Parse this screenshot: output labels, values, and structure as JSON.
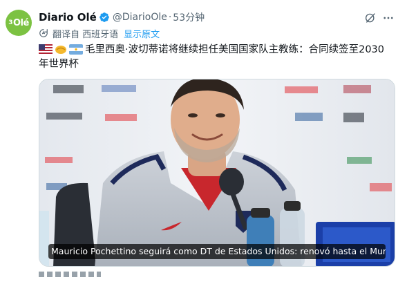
{
  "author": {
    "avatar_text_num": "3",
    "avatar_text": "Olé",
    "name": "Diario Olé",
    "handle": "@DiarioOle",
    "separator": "·",
    "time": "53分钟"
  },
  "translation": {
    "translated_from": "翻译自 西班牙语",
    "show_original": "显示原文"
  },
  "tweet": {
    "text": "毛里西奥·波切蒂诺将继续担任美国国家队主教练：合同续签至2030年世界杯"
  },
  "media": {
    "caption": "Mauricio Pochettino seguirá como DT de Estados Unidos: renovó hasta el Mun…"
  },
  "colors": {
    "accent": "#1d9bf0",
    "verified": "#1d9bf0",
    "avatar_bg": "#7cc242",
    "muted": "#536471"
  },
  "icons": {
    "verified": "verified-badge-icon",
    "grok": "grok-icon",
    "more": "more-icon",
    "translate": "translate-icon"
  }
}
